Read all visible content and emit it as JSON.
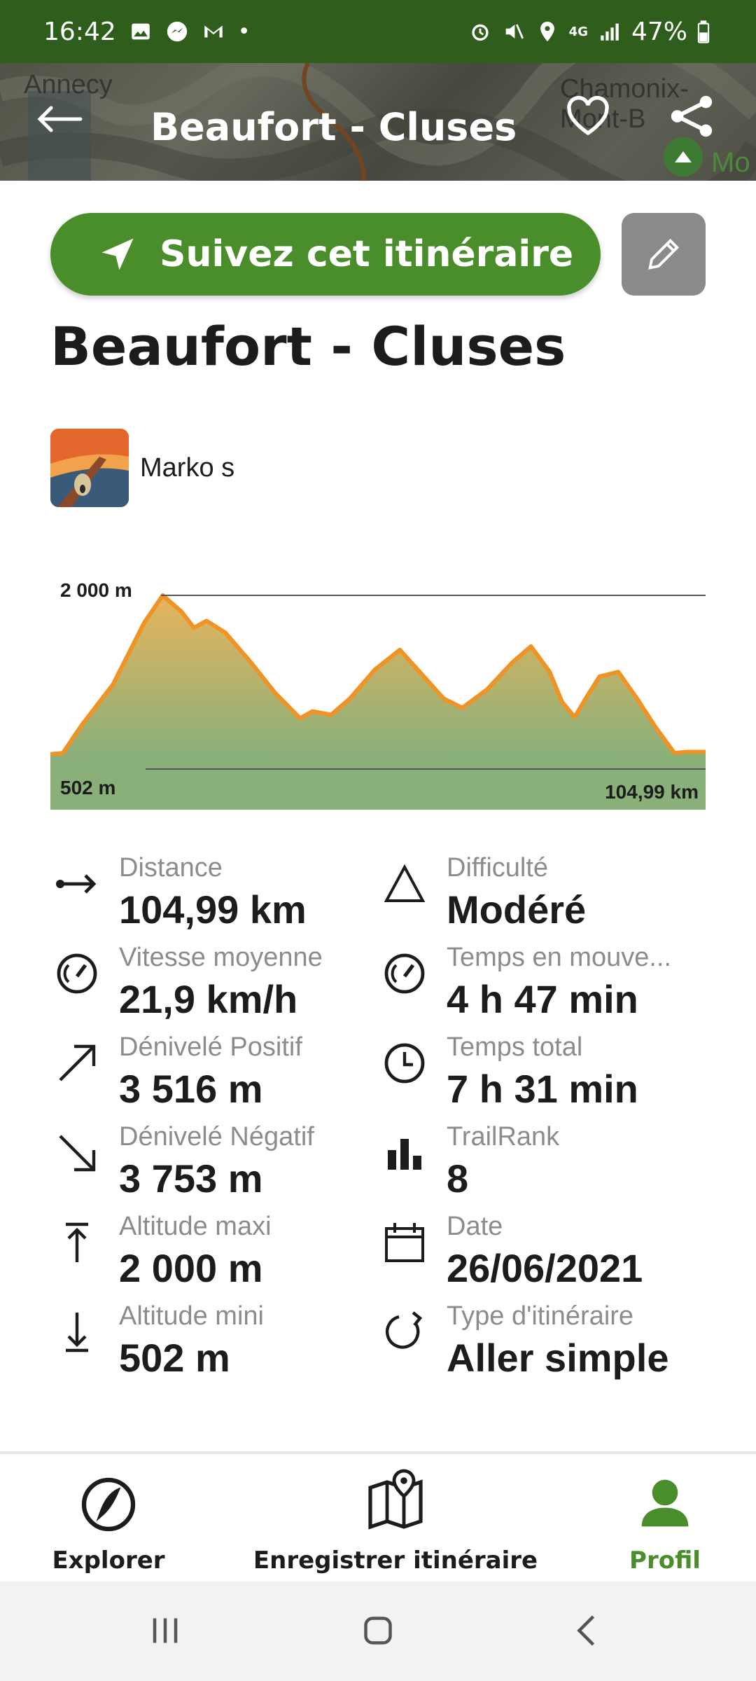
{
  "status_bar": {
    "time": "16:42",
    "battery": "47%",
    "network": "4G"
  },
  "header": {
    "title": "Beaufort - Cluses",
    "map_labels": [
      "Annecy",
      "Chamonix-Mont-B",
      "Mo"
    ]
  },
  "cta": {
    "follow_label": "Suivez cet itinéraire"
  },
  "route": {
    "title": "Beaufort - Cluses",
    "author": "Marko s"
  },
  "chart_data": {
    "type": "area",
    "max_label": "2 000 m",
    "min_label": "502 m",
    "distance_label": "104,99 km",
    "x": [
      0,
      2,
      5,
      10,
      15,
      18,
      21,
      23,
      25,
      28,
      32,
      36,
      40,
      42,
      45,
      48,
      52,
      56,
      60,
      63,
      66,
      70,
      74,
      77,
      80,
      82,
      84,
      86,
      88,
      91,
      94,
      97,
      100,
      102,
      104.99
    ],
    "y": [
      630,
      640,
      880,
      1230,
      1760,
      2000,
      1860,
      1720,
      1780,
      1680,
      1430,
      1160,
      940,
      1000,
      970,
      1110,
      1360,
      1530,
      1290,
      1110,
      1030,
      1190,
      1420,
      1560,
      1340,
      1080,
      950,
      1130,
      1300,
      1340,
      1110,
      860,
      640,
      650,
      650
    ],
    "ylim": [
      502,
      2000
    ],
    "xlim": [
      0,
      104.99
    ],
    "colors": {
      "line": "#f09224",
      "fill_top": "#e7b45c",
      "fill_bottom": "#8ab07a"
    }
  },
  "stats": {
    "left": [
      {
        "icon": "distance-icon",
        "label": "Distance",
        "value": "104,99 km"
      },
      {
        "icon": "speedometer-icon",
        "label": "Vitesse moyenne",
        "value": "21,9 km/h"
      },
      {
        "icon": "arrow-up-right-icon",
        "label": "Dénivelé Positif",
        "value": "3 516 m"
      },
      {
        "icon": "arrow-down-right-icon",
        "label": "Dénivelé Négatif",
        "value": "3 753 m"
      },
      {
        "icon": "altitude-max-icon",
        "label": "Altitude maxi",
        "value": "2 000 m"
      },
      {
        "icon": "altitude-min-icon",
        "label": "Altitude mini",
        "value": "502 m"
      }
    ],
    "right": [
      {
        "icon": "difficulty-triangle-icon",
        "label": "Difficulté",
        "value": "Modéré"
      },
      {
        "icon": "speedometer-icon",
        "label": "Temps en mouve...",
        "value": "4 h 47 min"
      },
      {
        "icon": "clock-icon",
        "label": "Temps total",
        "value": "7 h 31 min"
      },
      {
        "icon": "bar-chart-icon",
        "label": "TrailRank",
        "value": "8"
      },
      {
        "icon": "calendar-icon",
        "label": "Date",
        "value": "26/06/2021"
      },
      {
        "icon": "one-way-icon",
        "label": "Type d'itinéraire",
        "value": "Aller simple"
      }
    ]
  },
  "bottom_nav": {
    "explore": "Explorer",
    "record": "Enregistrer itinéraire",
    "profile": "Profil",
    "active_color": "#4a8d2b"
  }
}
